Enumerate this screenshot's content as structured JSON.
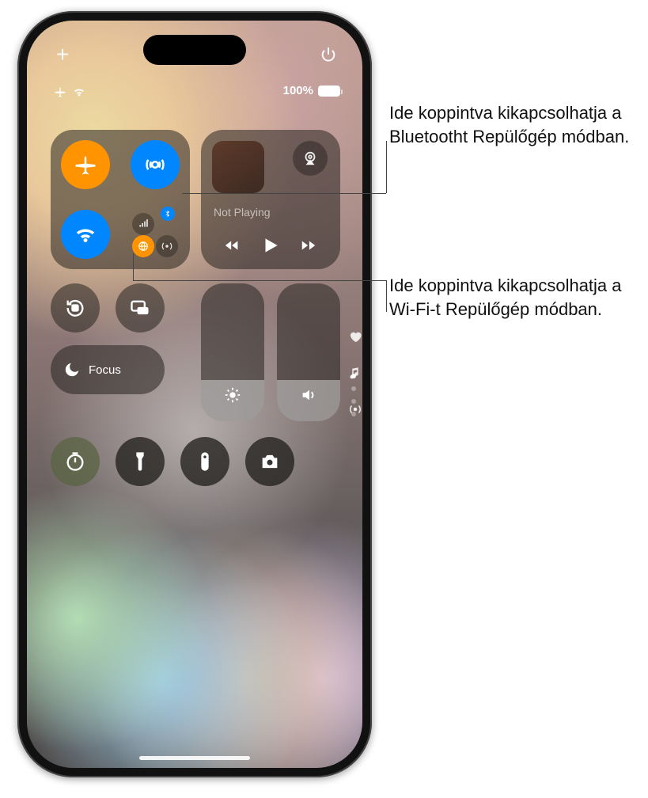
{
  "callouts": {
    "bluetooth": "Ide koppintva kikapcsolhatja a Bluetootht Repülőgép módban.",
    "wifi": "Ide koppintva kikapcsolhatja a Wi-Fi-t Repülőgép módban."
  },
  "status": {
    "battery_percent": "100%"
  },
  "media": {
    "now_playing_label": "Not Playing"
  },
  "focus": {
    "label": "Focus"
  },
  "icons": {
    "add": "+",
    "power": "power-icon",
    "airplane": "airplane-icon",
    "airdrop": "airdrop-icon",
    "wifi": "wifi-icon",
    "cellular": "cellular-icon",
    "bluetooth": "bluetooth-icon",
    "vpn": "vpn-icon",
    "airplay": "airplay-icon",
    "orientation_lock": "orientation-lock-icon",
    "screen_mirroring": "screen-mirroring-icon",
    "do_not_disturb": "moon-icon",
    "brightness": "sun-icon",
    "volume": "speaker-icon",
    "favorite": "heart-icon",
    "music": "music-note-icon",
    "broadcast": "broadcast-icon",
    "timer": "timer-icon",
    "flashlight": "flashlight-icon",
    "remote": "remote-icon",
    "camera": "camera-icon",
    "rewind": "rewind-icon",
    "play": "play-icon",
    "forward": "forward-icon"
  },
  "colors": {
    "active_orange": "#ff9500",
    "active_blue": "#0a84ff",
    "panel_bg": "rgba(40,36,34,.55)"
  }
}
